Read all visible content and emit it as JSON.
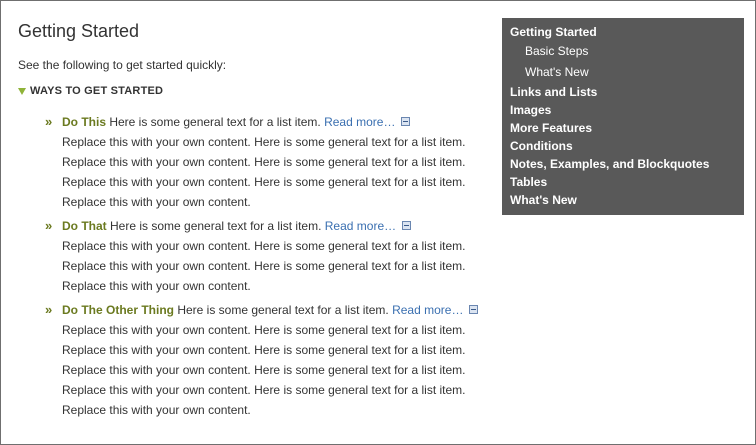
{
  "page": {
    "title": "Getting Started",
    "intro": "See the following to get started quickly:"
  },
  "section": {
    "label": "WAYS TO GET STARTED",
    "expanded": true
  },
  "items": [
    {
      "title": "Do This",
      "lead": " Here is some general text for a list item. ",
      "read_more": "Read more…",
      "lines": [
        "Replace this with your own content. Here is some general text for a list item.",
        "Replace this with your own content. Here is some general text for a list item.",
        "Replace this with your own content. Here is some general text for a list item.",
        "Replace this with your own content."
      ]
    },
    {
      "title": "Do That",
      "lead": " Here is some general text for a list item. ",
      "read_more": "Read more…",
      "lines": [
        "Replace this with your own content. Here is some general text for a list item.",
        "Replace this with your own content. Here is some general text for a list item.",
        "Replace this with your own content."
      ]
    },
    {
      "title": "Do The Other Thing",
      "lead": " Here is some general text for a list item. ",
      "read_more": "Read more…",
      "lines": [
        "Replace this with your own content. Here is some general text for a list item.",
        "Replace this with your own content. Here is some general text for a list item.",
        "Replace this with your own content. Here is some general text for a list item.",
        "Replace this with your own content. Here is some general text for a list item.",
        "Replace this with your own content."
      ]
    }
  ],
  "toc": {
    "items": [
      {
        "label": "Getting Started",
        "level": 1,
        "active": true
      },
      {
        "label": "Basic Steps",
        "level": 2
      },
      {
        "label": "What's New",
        "level": 2
      },
      {
        "label": "Links and Lists",
        "level": 1
      },
      {
        "label": "Images",
        "level": 1
      },
      {
        "label": "More Features",
        "level": 1
      },
      {
        "label": "Conditions",
        "level": 1
      },
      {
        "label": "Notes, Examples, and Blockquotes",
        "level": 1
      },
      {
        "label": "Tables",
        "level": 1
      },
      {
        "label": "What's New",
        "level": 1
      }
    ]
  },
  "icons": {
    "section_toggle": "triangle-down-icon",
    "item_bullet": "double-chevron-right-icon",
    "expand": "expand-box-icon"
  },
  "colors": {
    "toc_background": "#595959",
    "item_title": "#6b7a20",
    "link": "#3a6fb0",
    "toggle": "#8fb338"
  }
}
